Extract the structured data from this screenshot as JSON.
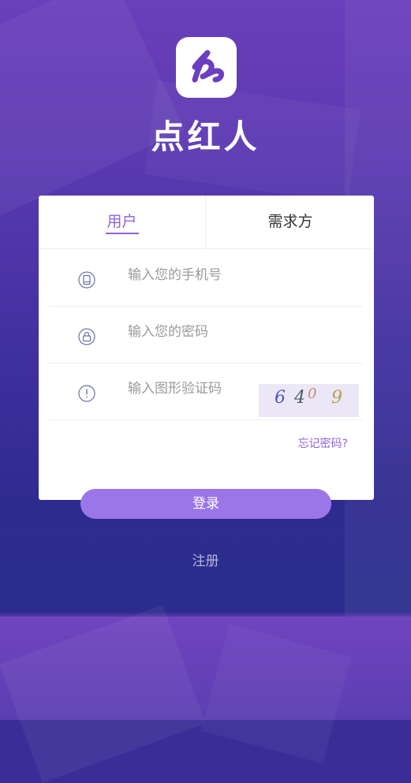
{
  "app": {
    "name": "点红人"
  },
  "tabs": [
    {
      "label": "用户",
      "active": true
    },
    {
      "label": "需求方",
      "active": false
    }
  ],
  "form": {
    "phone_placeholder": "输入您的手机号",
    "password_placeholder": "输入您的密码",
    "captcha_placeholder": "输入图形验证码",
    "captcha_chars": [
      "6",
      "4",
      "0",
      "9"
    ],
    "forgot_label": "忘记密码?"
  },
  "actions": {
    "login_label": "登录",
    "register_label": "注册"
  },
  "colors": {
    "accent": "#8f64d8",
    "button": "#9b76e8",
    "background_top": "#6a3fbb",
    "background_bottom": "#2b2d8e"
  },
  "icons": {
    "logo": "logo-icon",
    "phone": "phone-icon",
    "password": "lock-icon",
    "captcha": "exclamation-icon"
  }
}
